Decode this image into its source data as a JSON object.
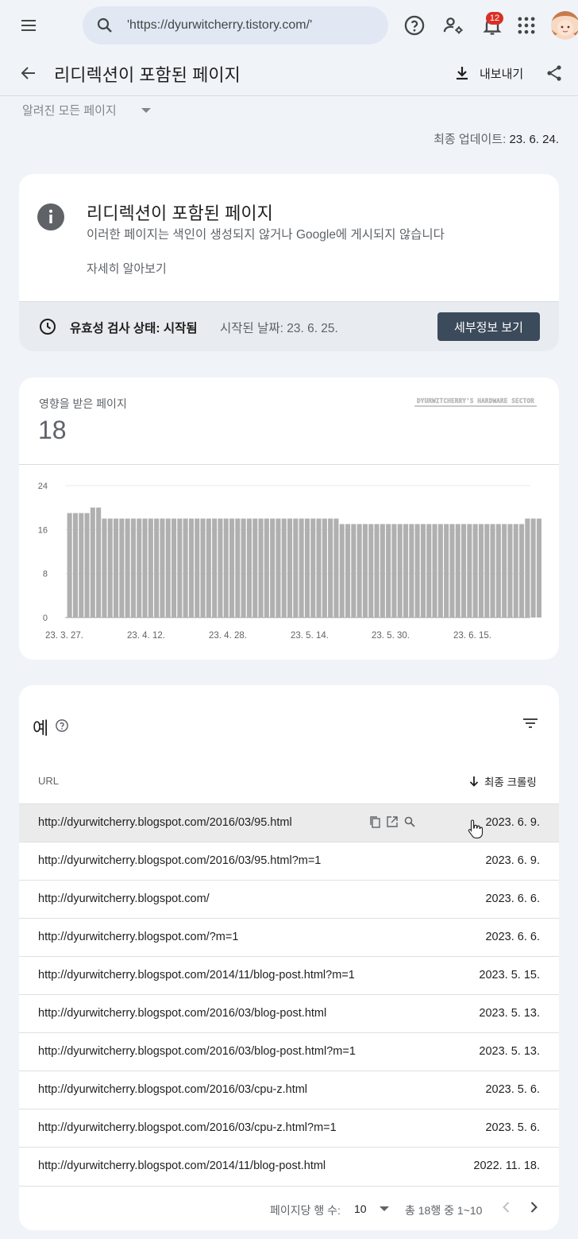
{
  "topbar": {
    "search_value": "'https://dyurwitcherry.tistory.com/'",
    "notification_count": "12"
  },
  "header": {
    "title": "리디렉션이 포함된 페이지",
    "export_label": "내보내기"
  },
  "filter": {
    "selected": "알려진 모든 페이지"
  },
  "last_updated": {
    "label": "최종 업데이트:",
    "value": "23. 6. 24."
  },
  "issue_card": {
    "title": "리디렉션이 포함된 페이지",
    "description": "이러한 페이지는 색인이 생성되지 않거나 Google에 게시되지 않습니다",
    "learn_more": "자세히 알아보기",
    "validation_label": "유효성 검사 상태: 시작됨",
    "validation_started": "시작된 날짜: 23. 6. 25.",
    "details_button": "세부정보 보기"
  },
  "affected": {
    "label": "영향을 받은 페이지",
    "count": "18",
    "watermark": "DYURWITCHERRY'S HARDWARE SECTOR"
  },
  "chart_data": {
    "type": "bar",
    "ylim": [
      0,
      24
    ],
    "y_ticks": [
      "24",
      "16",
      "8",
      "0"
    ],
    "y_tick_values": [
      24,
      16,
      8,
      0
    ],
    "x_tick_labels": [
      "23. 3. 27.",
      "23. 4. 12.",
      "23. 4. 28.",
      "23. 5. 14.",
      "23. 5. 30.",
      "23. 6. 15."
    ],
    "values": [
      19,
      19,
      19,
      19,
      20,
      20,
      18,
      18,
      18,
      18,
      18,
      18,
      18,
      18,
      18,
      18,
      18,
      18,
      18,
      18,
      18,
      18,
      18,
      18,
      18,
      18,
      18,
      18,
      18,
      18,
      18,
      18,
      18,
      18,
      18,
      18,
      18,
      18,
      18,
      18,
      18,
      18,
      18,
      18,
      18,
      18,
      18,
      17,
      17,
      17,
      17,
      17,
      17,
      17,
      17,
      17,
      17,
      17,
      17,
      17,
      17,
      17,
      17,
      17,
      17,
      17,
      17,
      17,
      17,
      17,
      17,
      17,
      17,
      17,
      17,
      17,
      17,
      17,
      17,
      18,
      18,
      18
    ],
    "bar_color": "#b0b0b0",
    "grid": true
  },
  "examples": {
    "title": "예",
    "col_url": "URL",
    "col_crawl": "최종 크롤링",
    "rows": [
      {
        "url": "http://dyurwitcherry.blogspot.com/2016/03/95.html",
        "date": "2023. 6. 9."
      },
      {
        "url": "http://dyurwitcherry.blogspot.com/2016/03/95.html?m=1",
        "date": "2023. 6. 9."
      },
      {
        "url": "http://dyurwitcherry.blogspot.com/",
        "date": "2023. 6. 6."
      },
      {
        "url": "http://dyurwitcherry.blogspot.com/?m=1",
        "date": "2023. 6. 6."
      },
      {
        "url": "http://dyurwitcherry.blogspot.com/2014/11/blog-post.html?m=1",
        "date": "2023. 5. 15."
      },
      {
        "url": "http://dyurwitcherry.blogspot.com/2016/03/blog-post.html",
        "date": "2023. 5. 13."
      },
      {
        "url": "http://dyurwitcherry.blogspot.com/2016/03/blog-post.html?m=1",
        "date": "2023. 5. 13."
      },
      {
        "url": "http://dyurwitcherry.blogspot.com/2016/03/cpu-z.html",
        "date": "2023. 5. 6."
      },
      {
        "url": "http://dyurwitcherry.blogspot.com/2016/03/cpu-z.html?m=1",
        "date": "2023. 5. 6."
      },
      {
        "url": "http://dyurwitcherry.blogspot.com/2014/11/blog-post.html",
        "date": "2022. 11. 18."
      }
    ],
    "rows_per_page_label": "페이지당 행 수:",
    "rows_per_page_value": "10",
    "range_label": "총 18행 중 1~10"
  }
}
